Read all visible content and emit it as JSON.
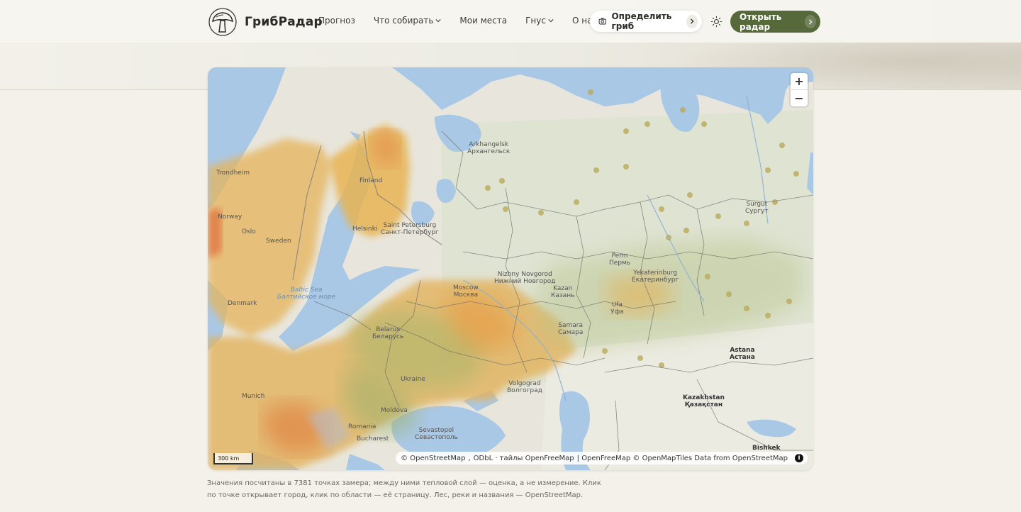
{
  "brand": {
    "name": "ГрибРадар",
    "logo_icon": "mushroom-icon"
  },
  "nav": {
    "items": [
      {
        "label": "Прогноз",
        "has_dropdown": false
      },
      {
        "label": "Что собирать",
        "has_dropdown": true
      },
      {
        "label": "Мои места",
        "has_dropdown": false
      },
      {
        "label": "Гнус",
        "has_dropdown": true
      },
      {
        "label": "О нас",
        "has_dropdown": true
      }
    ]
  },
  "actions": {
    "detect_label": "Определить гриб",
    "radar_label": "Открыть радар"
  },
  "colors": {
    "accent_green": "#55693a",
    "background": "#f3f1ea",
    "water": "#a9c8e6",
    "land": "#e8e6dc"
  },
  "map": {
    "zoom_in": "+",
    "zoom_out": "−",
    "scale": "300 km",
    "attribution": {
      "osm": "© OpenStreetMap",
      "odbl": "ODbL · тайлы OpenFreeMap",
      "rest": "| OpenFreeMap © OpenMapTiles Data from OpenStreetMap"
    },
    "labels": {
      "arkhangelsk": "Arkhangelsk",
      "arkhangelsk_ru": "Архангельск",
      "trondheim": "Trondheim",
      "finland": "Finland",
      "norway": "Norway",
      "oslo": "Oslo",
      "sweden": "Sweden",
      "helsinki": "Helsinki",
      "stpete": "Saint Petersburg",
      "stpete_ru": "Санкт-Петербург",
      "baltic": "Baltic Sea",
      "baltic_ru": "Балтийское море",
      "denmark": "Denmark",
      "moscow": "Moscow",
      "moscow_ru": "Москва",
      "nnovgorod": "Nizhny Novgorod",
      "nnovgorod_ru": "Нижний Новгород",
      "kazan": "Kazan",
      "kazan_ru": "Казань",
      "perm": "Perm",
      "perm_ru": "Пермь",
      "yekat": "Yekaterinburg",
      "yekat_ru": "Екатеринбург",
      "surgut": "Surgut",
      "surgut_ru": "Сургут",
      "ufa": "Ufa",
      "ufa_ru": "Уфа",
      "samara": "Samara",
      "samara_ru": "Самара",
      "belarus": "Belarus",
      "belarus_ru": "Беларусь",
      "ukraine": "Ukraine",
      "volgograd": "Volgograd",
      "volgograd_ru": "Волгоград",
      "astana": "Astana",
      "astana_ru": "Астана",
      "kazakhstan": "Kazakhstan",
      "kazakhstan_kz": "Қазақстан",
      "munich": "Munich",
      "moldova": "Moldova",
      "romania": "Romania",
      "bucharest": "Bucharest",
      "sevastopol": "Sevastopol",
      "sevastopol_ru": "Севастополь",
      "bishkek": "Bishkek"
    }
  },
  "caption": "Значения посчитаны в 7381 точках замера; между ними тепловой слой — оценка, а не измерение. Клик по точке открывает город, клик по области — её страницу. Лес, реки и названия — OpenStreetMap."
}
